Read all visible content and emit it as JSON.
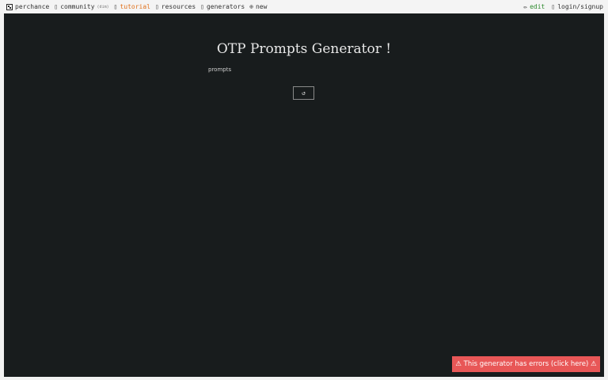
{
  "nav": {
    "brand": "perchance",
    "community": "community",
    "community_dim": "(dim)",
    "tutorial": "tutorial",
    "resources": "resources",
    "generators": "generators",
    "new": "new",
    "edit": "edit",
    "login": "login/signup",
    "icons": {
      "brand": "dice-icon",
      "community": "chat-icon",
      "tutorial": "book-icon",
      "resources": "folder-icon",
      "generators": "list-icon",
      "new": "plus-circle-icon",
      "edit": "pencil-icon",
      "login": "user-icon"
    }
  },
  "glyphs": {
    "community": "▯",
    "tutorial": "▯",
    "resources": "▯",
    "generators": "▯",
    "new": "⊕",
    "edit": "✏",
    "login": "▯"
  },
  "main": {
    "title": "OTP Prompts Generator !",
    "output_label": "prompts",
    "reroll_glyph": "↺"
  },
  "error_banner": "⚠ This generator has errors (click here) ⚠",
  "colors": {
    "frame_bg": "#181c1d",
    "tutorial": "#e0711c",
    "edit": "#2e8b2e",
    "error_bg": "#e85757"
  }
}
